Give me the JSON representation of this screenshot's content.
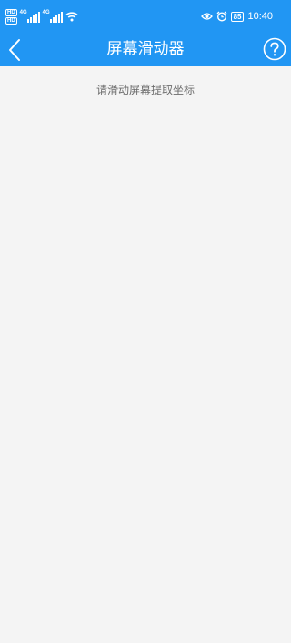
{
  "status_bar": {
    "hd_badges": [
      "HD",
      "HD"
    ],
    "sim1_network": "4G",
    "sim2_network": "4G",
    "wifi_icon": "wifi-icon",
    "eye_icon": "eye-icon",
    "alarm_icon": "alarm-icon",
    "battery": "85",
    "time": "10:40"
  },
  "app_bar": {
    "title": "屏幕滑动器",
    "back_icon": "chevron-left-icon",
    "help_icon": "question-circle-icon",
    "background_color": "#2196f3"
  },
  "content": {
    "hint": "请滑动屏幕提取坐标",
    "background_color": "#f4f4f4"
  }
}
